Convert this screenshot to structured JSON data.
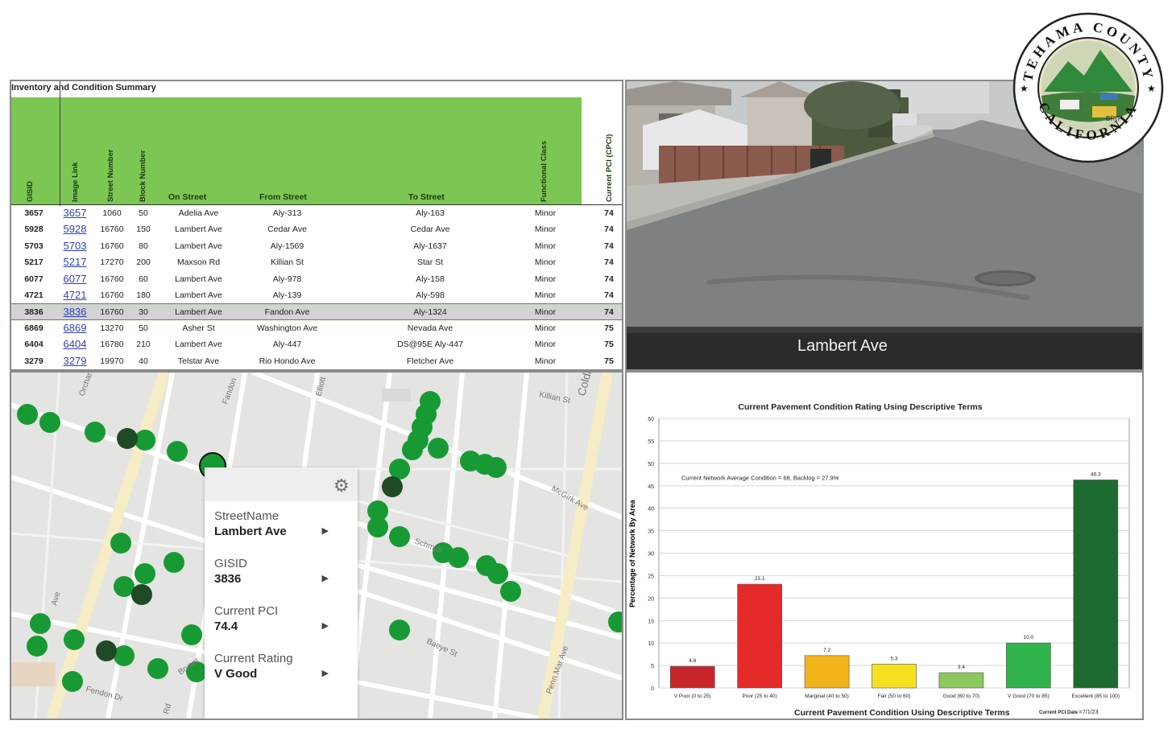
{
  "table": {
    "title": "Inventory and Condition Summary",
    "headers": {
      "gisid": "GISID",
      "image_link": "Image Link",
      "street_number": "Street Number",
      "block_number": "Block Number",
      "on_street": "On Street",
      "from_street": "From Street",
      "to_street": "To Street",
      "functional_class": "Functional Class",
      "pci": "Current PCI (CPCI)"
    },
    "selected_row_index": 6,
    "rows": [
      {
        "gisid": "3657",
        "link": "3657",
        "street_number": "1060",
        "block": "50",
        "on": "Adelia Ave",
        "from": "Aly-313",
        "to": "Aly-163",
        "class": "Minor",
        "pci": "74"
      },
      {
        "gisid": "5928",
        "link": "5928",
        "street_number": "16760",
        "block": "150",
        "on": "Lambert Ave",
        "from": "Cedar Ave",
        "to": "Cedar Ave",
        "class": "Minor",
        "pci": "74"
      },
      {
        "gisid": "5703",
        "link": "5703",
        "street_number": "16760",
        "block": "80",
        "on": "Lambert Ave",
        "from": "Aly-1569",
        "to": "Aly-1637",
        "class": "Minor",
        "pci": "74"
      },
      {
        "gisid": "5217",
        "link": "5217",
        "street_number": "17270",
        "block": "200",
        "on": "Maxson Rd",
        "from": "Killian St",
        "to": "Star St",
        "class": "Minor",
        "pci": "74"
      },
      {
        "gisid": "6077",
        "link": "6077",
        "street_number": "16760",
        "block": "60",
        "on": "Lambert Ave",
        "from": "Aly-978",
        "to": "Aly-158",
        "class": "Minor",
        "pci": "74"
      },
      {
        "gisid": "4721",
        "link": "4721",
        "street_number": "16760",
        "block": "180",
        "on": "Lambert Ave",
        "from": "Aly-139",
        "to": "Aly-598",
        "class": "Minor",
        "pci": "74"
      },
      {
        "gisid": "3836",
        "link": "3836",
        "street_number": "16760",
        "block": "30",
        "on": "Lambert Ave",
        "from": "Fandon Ave",
        "to": "Aly-1324",
        "class": "Minor",
        "pci": "74"
      },
      {
        "gisid": "6869",
        "link": "6869",
        "street_number": "13270",
        "block": "50",
        "on": "Asher St",
        "from": "Washington Ave",
        "to": "Nevada Ave",
        "class": "Minor",
        "pci": "75"
      },
      {
        "gisid": "6404",
        "link": "6404",
        "street_number": "16780",
        "block": "210",
        "on": "Lambert Ave",
        "from": "Aly-447",
        "to": "DS@95E Aly-447",
        "class": "Minor",
        "pci": "75"
      },
      {
        "gisid": "3279",
        "link": "3279",
        "street_number": "19970",
        "block": "40",
        "on": "Telstar Ave",
        "from": "Rio Hondo Ave",
        "to": "Fletcher Ave",
        "class": "Minor",
        "pci": "75"
      }
    ]
  },
  "photo": {
    "caption": "Lambert Ave"
  },
  "map": {
    "labels": [
      "Killian St",
      "McGirk Ave",
      "Baeye St",
      "Penn Mar Ave",
      "Fandon",
      "Bryant",
      "Orchard",
      "Fendon Dr",
      "Coldbrook Ave",
      "Elliott",
      "Schmidt",
      "Ave",
      "Rd"
    ],
    "popup": {
      "fields": [
        {
          "label": "StreetName",
          "value": "Lambert Ave"
        },
        {
          "label": "GISID",
          "value": "3836"
        },
        {
          "label": "Current PCI",
          "value": "74.4"
        },
        {
          "label": "Current Rating",
          "value": "V Good"
        }
      ]
    }
  },
  "chart_data": {
    "type": "bar",
    "title": "Current Pavement Condition Rating Using Descriptive Terms",
    "subtitle": "Current Network Average Condition = 68, Backlog = 27.9%",
    "xlabel": "Current Pavement Condition Using Descriptive Terms",
    "ylabel": "Percentage of Network By Area",
    "date_label": "Current PCI Date =",
    "date": "7/1/23",
    "categories": [
      "V Poor (0 to 25)",
      "Poor (25 to 40)",
      "Marginal (40 to 50)",
      "Fair (50 to 60)",
      "Good (60 to 70)",
      "V Good (70 to 85)",
      "Excellent (85 to 100)"
    ],
    "values": [
      4.8,
      23.1,
      7.2,
      5.3,
      3.4,
      10.0,
      46.3
    ],
    "value_labels": [
      "4.8",
      "23.1",
      "7.2",
      "5.3",
      "3.4",
      "10.0",
      "46.3"
    ],
    "colors": [
      "#c8252a",
      "#e52a2a",
      "#f3b31a",
      "#f4e01f",
      "#8cc85b",
      "#2fb34a",
      "#1d6b30"
    ],
    "ylim": [
      0,
      60
    ],
    "yticks": [
      0,
      5,
      10,
      15,
      20,
      25,
      30,
      35,
      40,
      45,
      50,
      55,
      60
    ],
    "grid": true,
    "legend": "none"
  },
  "seal": {
    "top_text": "TEHAMA COUNTY",
    "bottom_text": "CALIFORNIA",
    "banner": "BRIT"
  },
  "colors": {
    "header_green": "#7cc653",
    "marker_green": "#179a34",
    "marker_dark": "#1f4a26",
    "link_blue": "#2f3fb8"
  }
}
